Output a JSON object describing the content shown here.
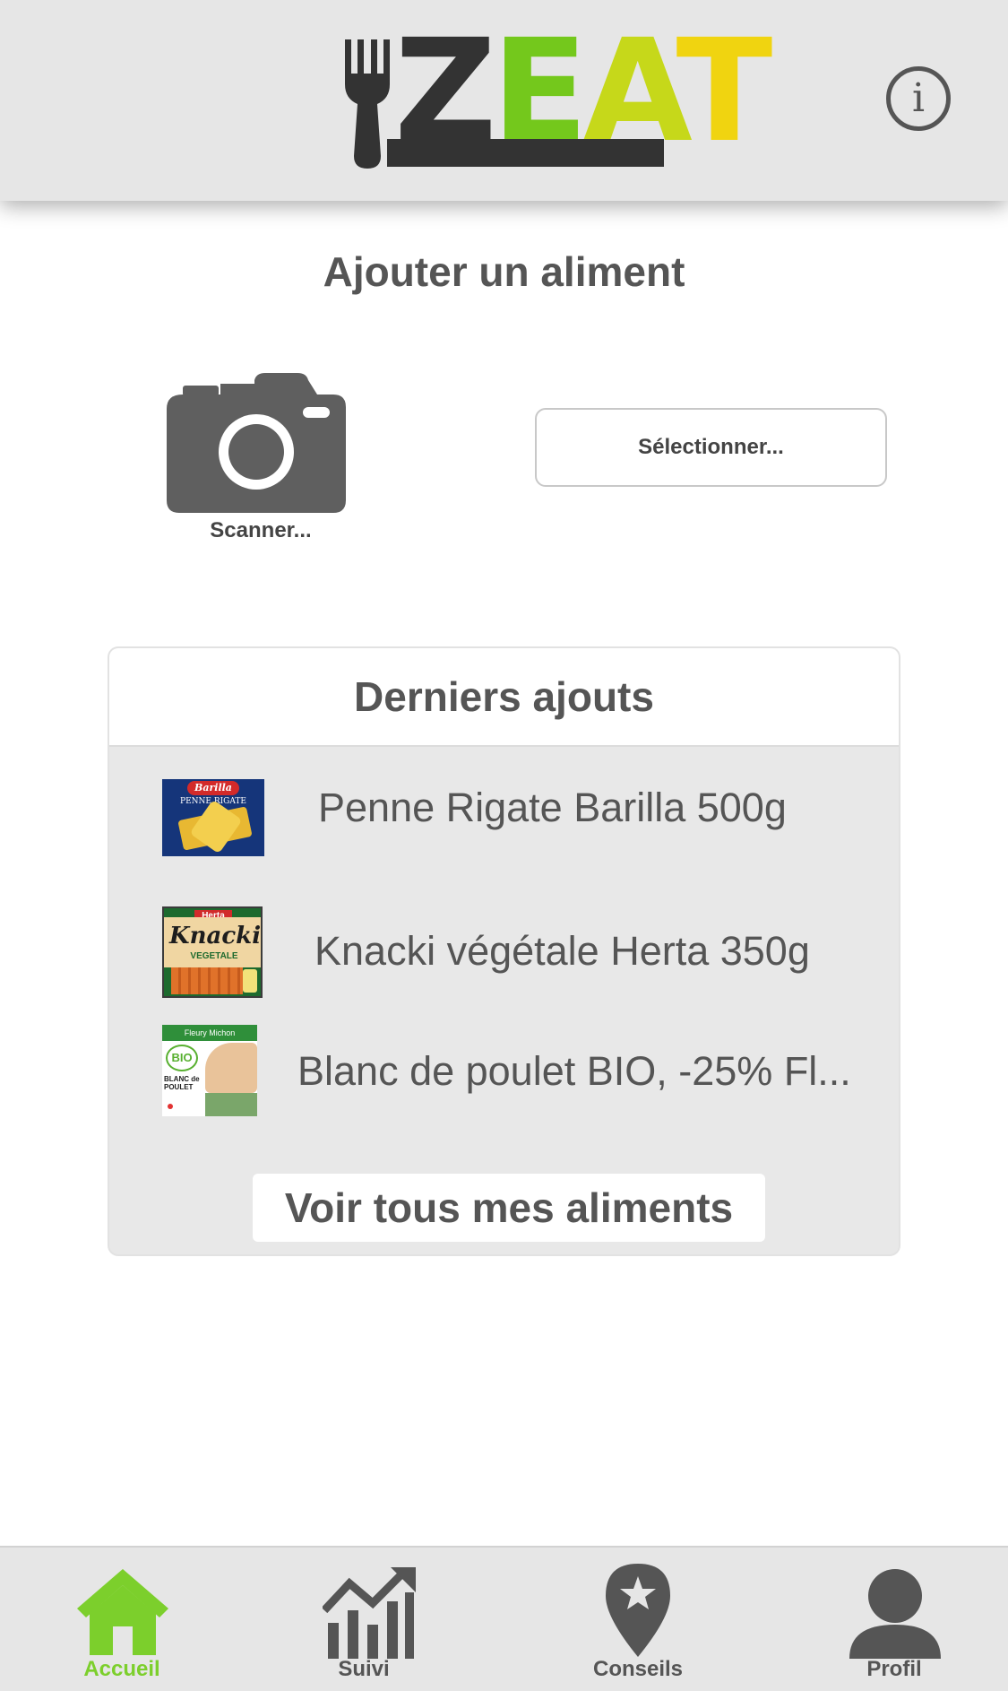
{
  "header": {
    "logo_letters": [
      "Z",
      "E",
      "A",
      "T"
    ],
    "info_glyph": "i"
  },
  "add_food": {
    "title": "Ajouter un aliment",
    "scan_label": "Scanner...",
    "select_label": "Sélectionner..."
  },
  "recent": {
    "title": "Derniers ajouts",
    "items": [
      {
        "name": "Penne Rigate Barilla 500g",
        "thumb_brand": "Barilla",
        "thumb_text": "PENNE RIGATE"
      },
      {
        "name": "Knacki végétale Herta 350g",
        "thumb_brand": "Herta",
        "thumb_text": "Knacki",
        "thumb_sub": "VEGETALE"
      },
      {
        "name": "Blanc de poulet BIO, -25% Fl...",
        "thumb_brand": "Fleury Michon",
        "thumb_text": "BIO",
        "thumb_sub": "BLANC de POULET"
      }
    ],
    "see_all_label": "Voir tous mes aliments"
  },
  "tabbar": {
    "tabs": [
      {
        "label": "Accueil",
        "icon": "home-icon",
        "active": true
      },
      {
        "label": "Suivi",
        "icon": "chart-trend-icon",
        "active": false
      },
      {
        "label": "Conseils",
        "icon": "map-pin-star-icon",
        "active": false
      },
      {
        "label": "Profil",
        "icon": "user-icon",
        "active": false
      }
    ]
  },
  "colors": {
    "accent_green": "#7ccf2c",
    "logo_dark": "#333333",
    "logo_green": "#74c81c",
    "logo_lime": "#c6d81a",
    "logo_yellow": "#f0d410",
    "icon_gray": "#555555"
  }
}
